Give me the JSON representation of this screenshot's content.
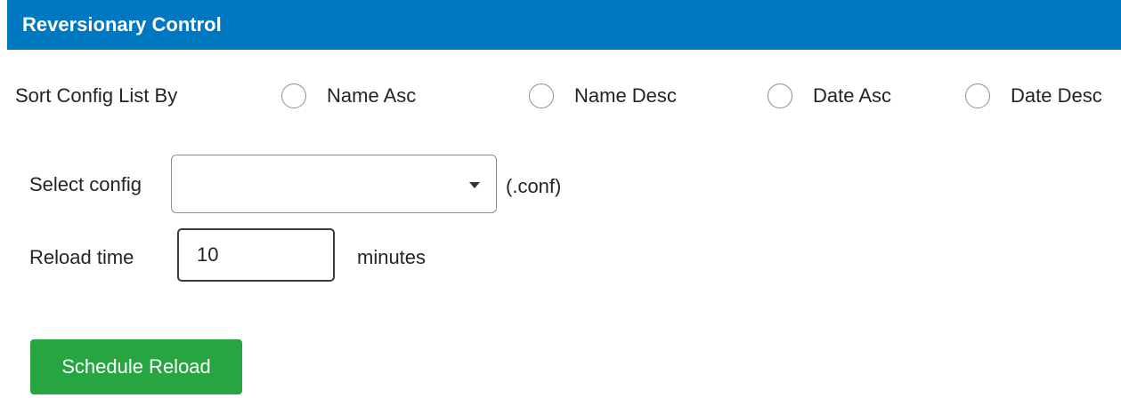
{
  "header": {
    "title": "Reversionary Control"
  },
  "sort": {
    "label": "Sort Config List By",
    "options": [
      {
        "label": "Name Asc",
        "selected": false
      },
      {
        "label": "Name Desc",
        "selected": false
      },
      {
        "label": "Date Asc",
        "selected": false
      },
      {
        "label": "Date Desc",
        "selected": false
      }
    ]
  },
  "config": {
    "label": "Select config",
    "value": "",
    "suffix": "(.conf)"
  },
  "reload": {
    "label": "Reload time",
    "value": "10",
    "unit": "minutes"
  },
  "actions": {
    "schedule_label": "Schedule Reload"
  },
  "colors": {
    "header": "#0077c1",
    "button": "#26a540"
  },
  "icons": {
    "dropdown": "caret-down-icon",
    "radio": "radio-unselected-icon"
  }
}
